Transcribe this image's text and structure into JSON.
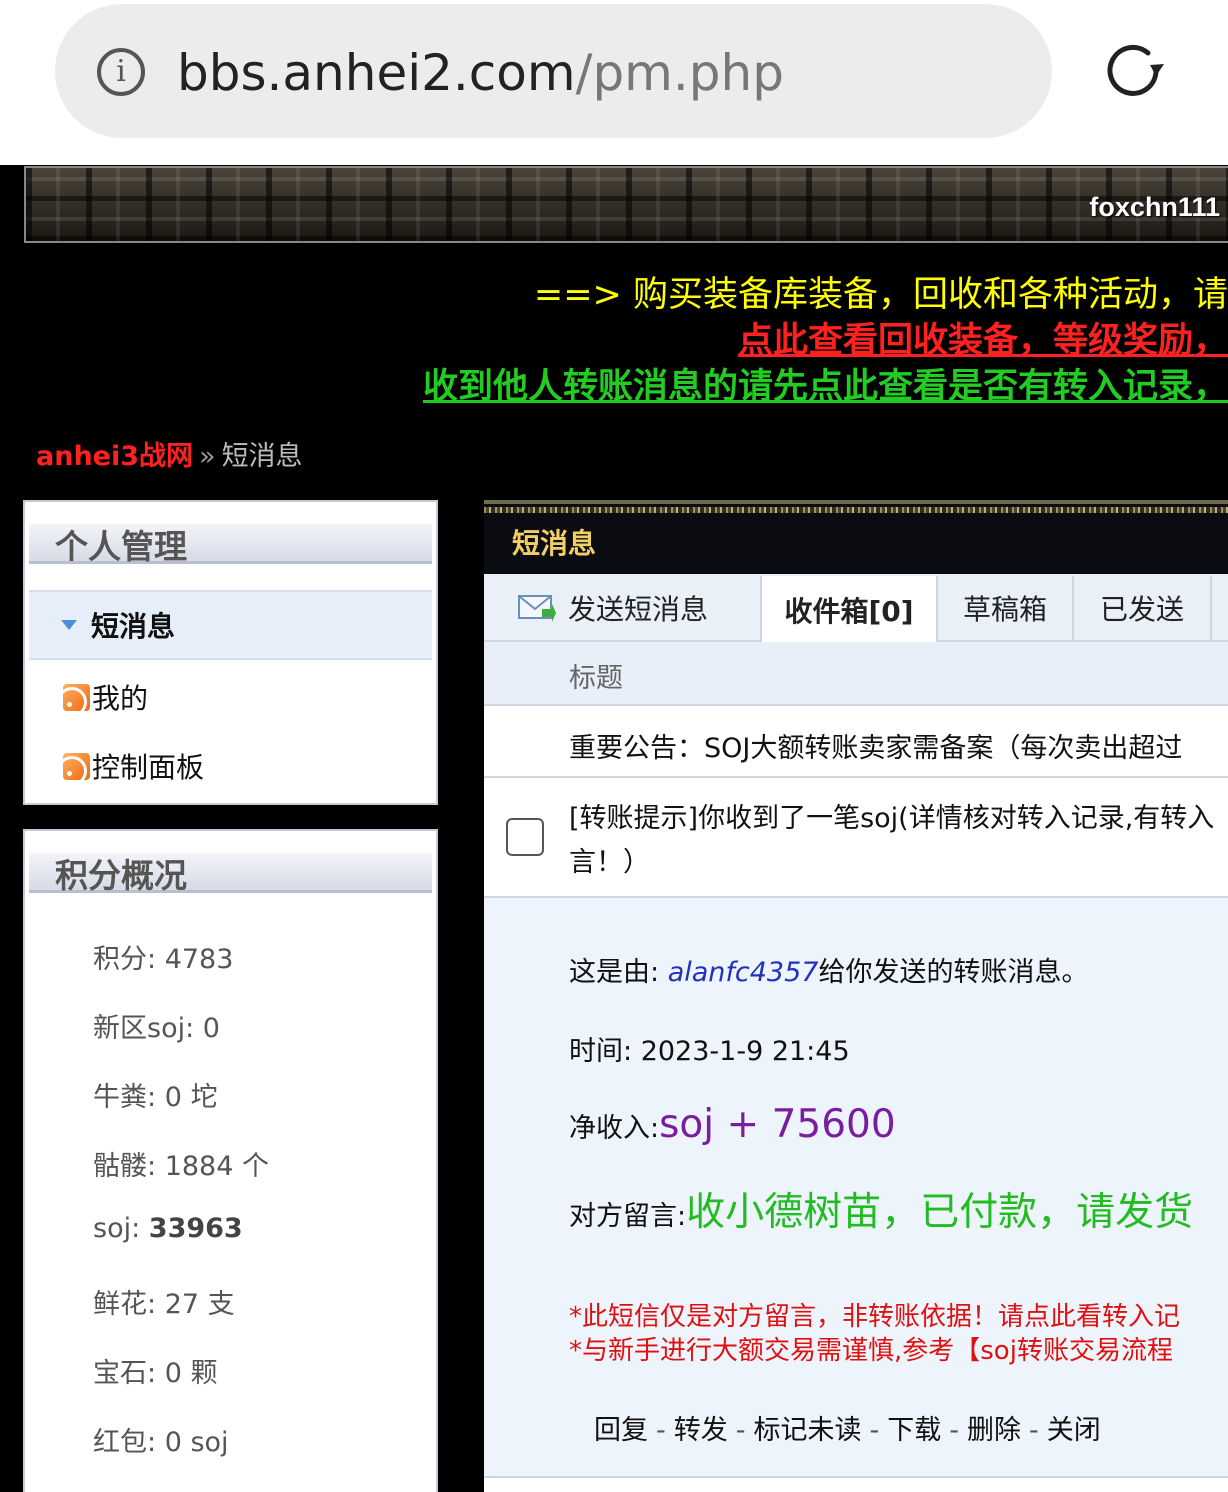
{
  "browser": {
    "url_host": "bbs.anhei2.com",
    "url_path": "/pm.php"
  },
  "header": {
    "username": "foxchn111"
  },
  "notices": [
    "==> 购买装备库装备，回收和各种活动，请",
    "点此查看回收装备，等级奖励，",
    "收到他人转账消息的请先点此查看是否有转入记录，"
  ],
  "breadcrumb": {
    "home": "anhei3战网",
    "separator": "»",
    "current": "短消息"
  },
  "sidebar": {
    "personal": {
      "title": "个人管理",
      "items": [
        {
          "label": "短消息"
        },
        {
          "label": "我的"
        },
        {
          "label": "控制面板"
        }
      ]
    },
    "credits": {
      "title": "积分概况",
      "stats": [
        {
          "label": "积分: ",
          "value": "4783"
        },
        {
          "label": "新区soj: ",
          "value": "0"
        },
        {
          "label": "牛粪: ",
          "value": "0 坨"
        },
        {
          "label": "骷髅: ",
          "value": "1884 个"
        },
        {
          "label": "soj: ",
          "value": "33963"
        },
        {
          "label": "鲜花: ",
          "value": "27 支"
        },
        {
          "label": "宝石: ",
          "value": "0 颗"
        },
        {
          "label": "红包: ",
          "value": "0 soj"
        }
      ]
    }
  },
  "main": {
    "title": "短消息",
    "tabs": [
      {
        "label": "发送短消息"
      },
      {
        "label": "收件箱[0]"
      },
      {
        "label": "草稿箱"
      },
      {
        "label": "已发送"
      }
    ],
    "column_title": "标题",
    "messages": [
      {
        "title": "重要公告：SOJ大额转账卖家需备案（每次卖出超过"
      },
      {
        "title_line1": "[转账提示]你收到了一笔soj(详情核对转入记录,有转入",
        "title_line2": "言！）"
      }
    ],
    "detail": {
      "from_prefix": "这是由: ",
      "sender": "alanfc4357",
      "from_suffix": "给你发送的转账消息。",
      "time_label": "时间: ",
      "time_value": "2023-1-9 21:45",
      "net_label": "净收入:",
      "net_value": "soj + 75600",
      "note_label": "对方留言:",
      "note_value": "收小德树苗，已付款，请发货",
      "warning1": "*此短信仅是对方留言，非转账依据！请点此看转入记",
      "warning2": "*与新手进行大额交易需谨慎,参考【soj转账交易流程"
    },
    "actions": [
      "回复",
      "转发",
      "标记未读",
      "下载",
      "删除",
      "关闭"
    ],
    "action_separator": "-"
  }
}
